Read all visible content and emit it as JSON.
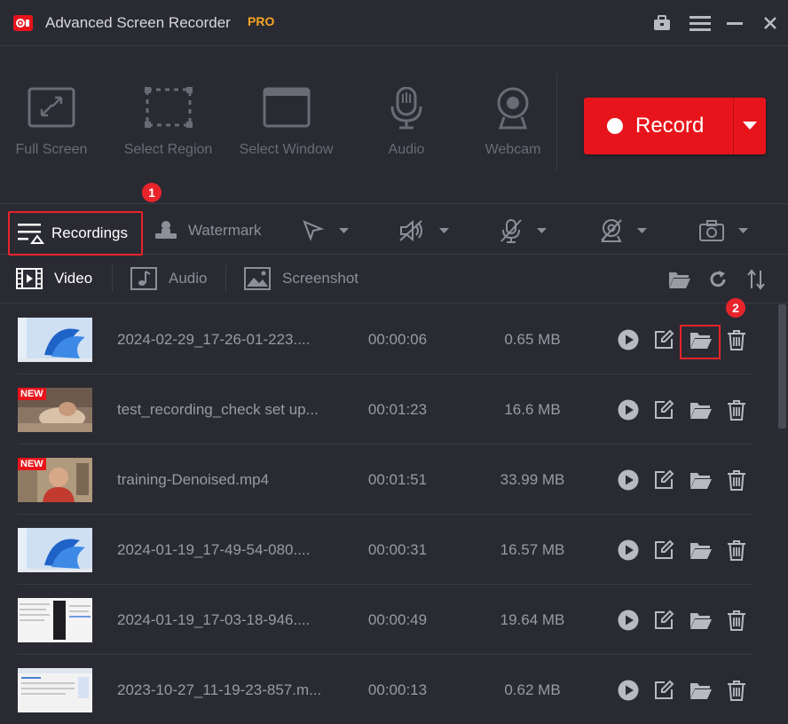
{
  "app": {
    "title": "Advanced Screen Recorder",
    "edition": "PRO"
  },
  "toolbar": {
    "tools": [
      {
        "label": "Full Screen",
        "icon": "full-screen-icon"
      },
      {
        "label": "Select Region",
        "icon": "select-region-icon"
      },
      {
        "label": "Select Window",
        "icon": "select-window-icon"
      },
      {
        "label": "Audio",
        "icon": "microphone-icon"
      },
      {
        "label": "Webcam",
        "icon": "webcam-icon"
      }
    ],
    "record_label": "Record"
  },
  "secondary": {
    "recordings_label": "Recordings",
    "watermark_label": "Watermark"
  },
  "annotations": {
    "step1": "1",
    "step2": "2"
  },
  "media_tabs": {
    "video": "Video",
    "audio": "Audio",
    "screenshot": "Screenshot",
    "active": "Video"
  },
  "recordings": [
    {
      "name": "2024-02-29_17-26-01-223....",
      "duration": "00:00:06",
      "size": "0.65 MB",
      "is_new": false,
      "thumb": "win11"
    },
    {
      "name": "test_recording_check set up...",
      "duration": "00:01:23",
      "size": "16.6 MB",
      "is_new": true,
      "thumb": "photo"
    },
    {
      "name": "training-Denoised.mp4",
      "duration": "00:01:51",
      "size": "33.99 MB",
      "is_new": true,
      "thumb": "person"
    },
    {
      "name": "2024-01-19_17-49-54-080....",
      "duration": "00:00:31",
      "size": "16.57 MB",
      "is_new": false,
      "thumb": "win11"
    },
    {
      "name": "2024-01-19_17-03-18-946....",
      "duration": "00:00:49",
      "size": "19.64 MB",
      "is_new": false,
      "thumb": "doc"
    },
    {
      "name": "2023-10-27_11-19-23-857.m...",
      "duration": "00:00:13",
      "size": "0.62 MB",
      "is_new": false,
      "thumb": "doc2"
    }
  ],
  "new_tag": "NEW",
  "colors": {
    "accent": "#e8141b",
    "pro": "#f5a623",
    "background": "#2a2a33"
  }
}
